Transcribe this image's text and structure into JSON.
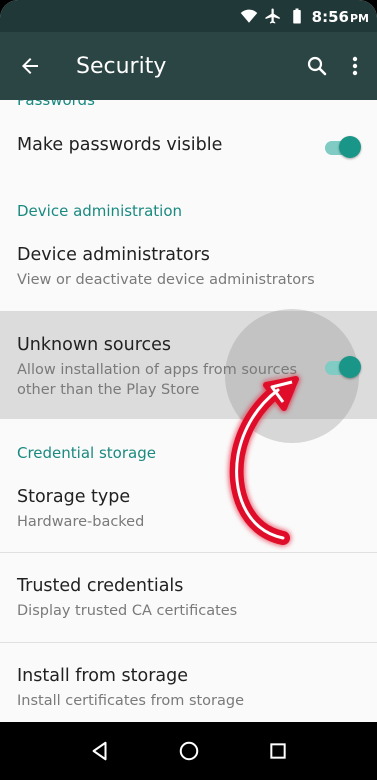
{
  "status_bar": {
    "time": "8:56",
    "ampm": "PM"
  },
  "app_bar": {
    "title": "Security"
  },
  "sections": {
    "passwords": "Passwords",
    "device_administration": "Device administration",
    "credential_storage": "Credential storage"
  },
  "rows": {
    "make_passwords_visible": {
      "label": "Make passwords visible",
      "enabled": true
    },
    "device_administrators": {
      "label": "Device administrators",
      "summary": "View or deactivate device administrators"
    },
    "unknown_sources": {
      "label": "Unknown sources",
      "summary_line1": "Allow installation of apps from sources",
      "summary_line2": "other than the Play Store",
      "enabled": true
    },
    "storage_type": {
      "label": "Storage type",
      "summary": "Hardware-backed"
    },
    "trusted_credentials": {
      "label": "Trusted credentials",
      "summary": "Display trusted CA certificates"
    },
    "install_from_storage": {
      "label": "Install from storage",
      "summary": "Install certificates from storage"
    }
  },
  "colors": {
    "status_bar": "#213838",
    "app_bar": "#2b4444",
    "accent": "#1a8a80",
    "toggle_thumb": "#1a9688",
    "toggle_track": "#80cbc4",
    "annotation_arrow": "#e0102a"
  },
  "icons": {
    "status": [
      "wifi-icon",
      "airplane-icon",
      "battery-icon"
    ],
    "app_bar": [
      "back-arrow-icon",
      "search-icon",
      "more-vert-icon"
    ],
    "nav": [
      "back-triangle-icon",
      "home-circle-icon",
      "recents-square-icon"
    ]
  }
}
